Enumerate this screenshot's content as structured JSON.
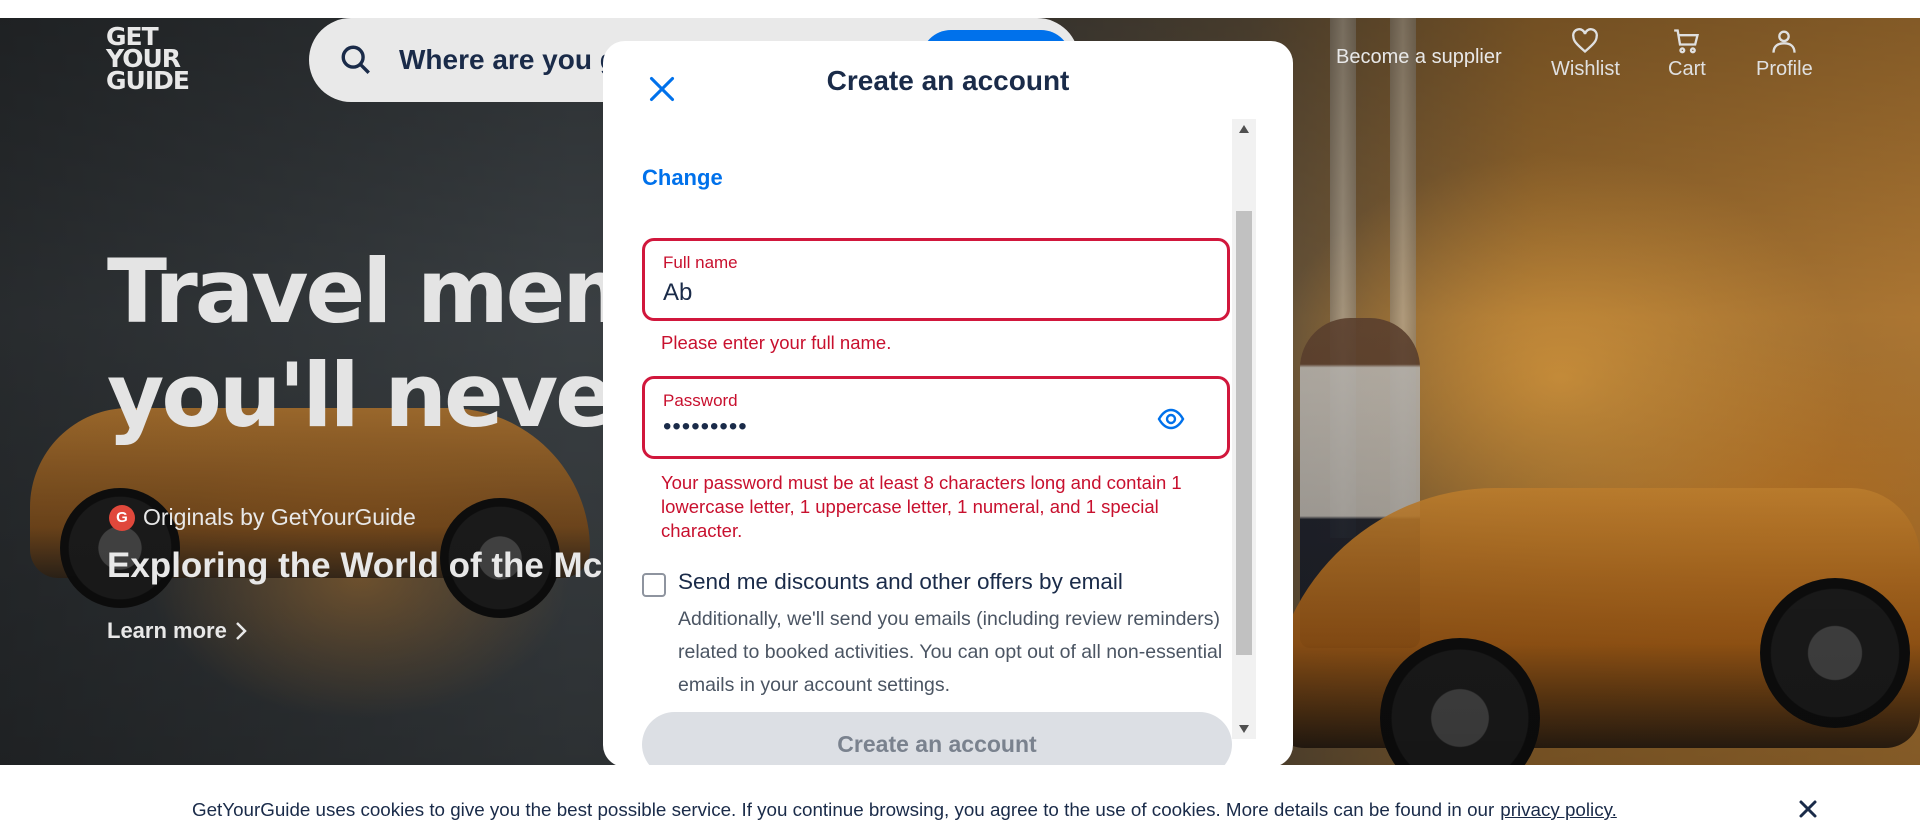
{
  "header": {
    "logo_lines": [
      "GET",
      "YOUR",
      "GUIDE"
    ],
    "search_placeholder": "Where are you g",
    "become_supplier": "Become a supplier",
    "nav": [
      {
        "label": "Wishlist",
        "icon": "heart-icon"
      },
      {
        "label": "Cart",
        "icon": "cart-icon"
      },
      {
        "label": "Profile",
        "icon": "profile-icon"
      }
    ]
  },
  "hero": {
    "title_line1": "Travel memo",
    "title_line2": "you'll never f",
    "originals_badge": "G",
    "originals": "Originals by GetYourGuide",
    "subtitle": "Exploring the World of the McL",
    "learn_more": "Learn more"
  },
  "modal": {
    "title": "Create an account",
    "change_link": "Change",
    "full_name": {
      "label": "Full name",
      "value": "Ab",
      "error": "Please enter your full name."
    },
    "password": {
      "label": "Password",
      "value": "•••••••••",
      "error": "Your password must be at least 8 characters long and contain 1 lowercase letter, 1 uppercase letter, 1 numeral, and 1 special character."
    },
    "email_opt_in": {
      "label": "Send me discounts and other offers by email",
      "description": "Additionally, we'll send you emails (including review reminders) related to booked activities. You can opt out of all non-essential emails in your account settings.",
      "checked": false
    },
    "submit": "Create an account"
  },
  "cookie": {
    "text": "GetYourGuide uses cookies to give you the best possible service. If you continue browsing, you agree to the use of cookies. More details can be found in our",
    "link": "privacy policy."
  },
  "colors": {
    "brand_blue": "#0071eb",
    "error_red": "#d1173c",
    "text_dark": "#1a2b49",
    "disabled_button": "#dcdfe4"
  }
}
